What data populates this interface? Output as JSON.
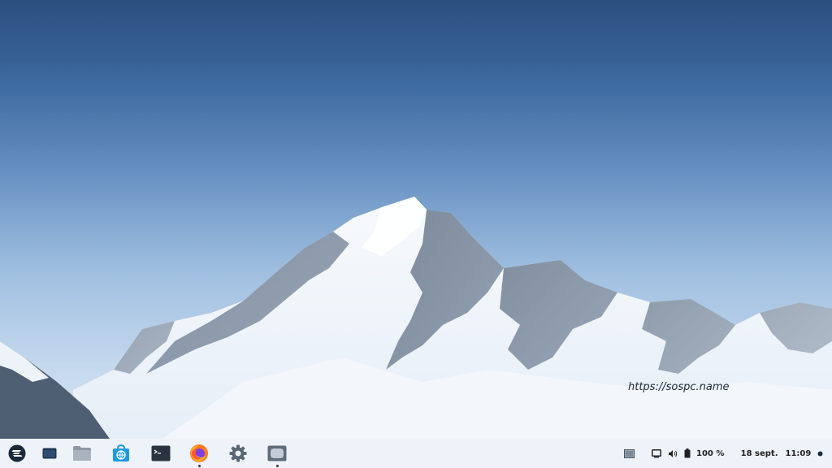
{
  "wallpaper": {
    "watermark": "https://sospc.name"
  },
  "taskbar": {
    "launcher_icon": "zorin-logo-icon",
    "apps": [
      {
        "name": "show-desktop-icon",
        "running": false
      },
      {
        "name": "files-icon",
        "running": false
      },
      {
        "name": "software-store-icon",
        "running": false
      },
      {
        "name": "terminal-icon",
        "running": false
      },
      {
        "name": "firefox-icon",
        "running": true
      },
      {
        "name": "settings-gear-icon",
        "running": false
      },
      {
        "name": "screenshot-icon",
        "running": true
      }
    ],
    "tray": {
      "workspace_icon": "workspace-icon",
      "display_icon": "display-icon",
      "volume_icon": "volume-icon",
      "battery_icon": "battery-icon",
      "battery_percent": "100 %",
      "date": "18 sept.",
      "time": "11:09",
      "notification_icon": "notification-dot-icon"
    }
  },
  "colors": {
    "sky_top": "#2c4f7f",
    "sky_bottom": "#dfe9f4",
    "taskbar_bg": "#f0f4f9",
    "store_blue": "#1e9be0",
    "firefox_orange": "#ff7a1a",
    "firefox_purple": "#7b3fe4"
  }
}
